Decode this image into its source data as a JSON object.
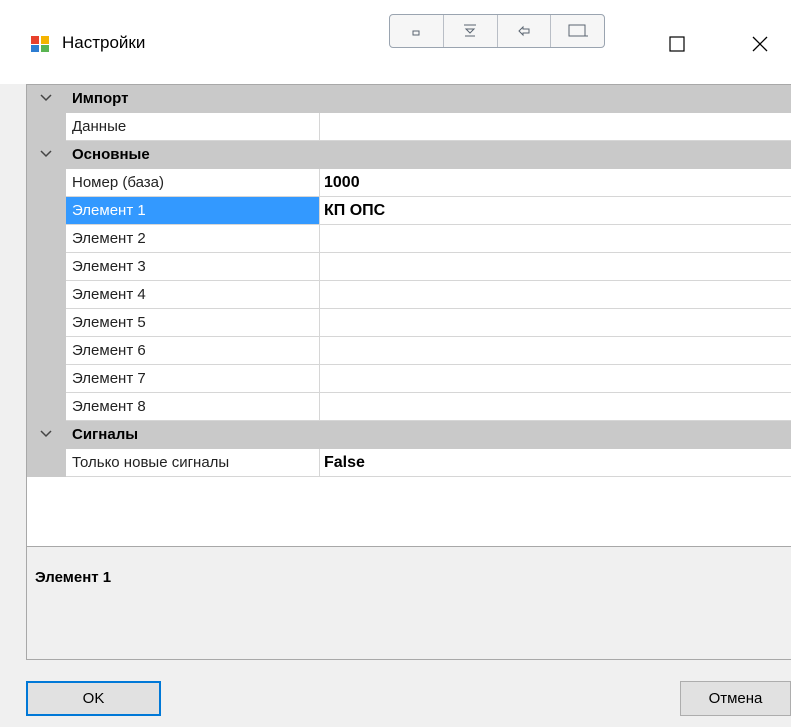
{
  "window": {
    "title": "Настройки",
    "app_icon": "app-window-icon",
    "toolstrip_icons": [
      "minimize-small-icon",
      "pin-top-icon",
      "pin-side-icon",
      "restore-small-icon"
    ],
    "maximize_icon": "maximize-icon",
    "close_icon": "close-icon"
  },
  "grid": {
    "categories": [
      {
        "label": "Импорт",
        "properties": [
          {
            "name": "Данные",
            "value": ""
          }
        ]
      },
      {
        "label": "Основные",
        "properties": [
          {
            "name": "Номер (база)",
            "value": "1000"
          },
          {
            "name": "Элемент 1",
            "value": "КП ОПС"
          },
          {
            "name": "Элемент 2",
            "value": ""
          },
          {
            "name": "Элемент 3",
            "value": ""
          },
          {
            "name": "Элемент 4",
            "value": ""
          },
          {
            "name": "Элемент 5",
            "value": ""
          },
          {
            "name": "Элемент 6",
            "value": ""
          },
          {
            "name": "Элемент 7",
            "value": ""
          },
          {
            "name": "Элемент 8",
            "value": ""
          }
        ]
      },
      {
        "label": "Сигналы",
        "properties": [
          {
            "name": "Только новые сигналы",
            "value": "False"
          }
        ]
      }
    ],
    "selected": "Элемент 1"
  },
  "description": {
    "title": "Элемент 1"
  },
  "buttons": {
    "ok_label": "OK",
    "cancel_label": "Отмена"
  },
  "colors": {
    "selection": "#3399ff",
    "category_bg": "#c9c9c9",
    "default_button_border": "#0078d7"
  }
}
